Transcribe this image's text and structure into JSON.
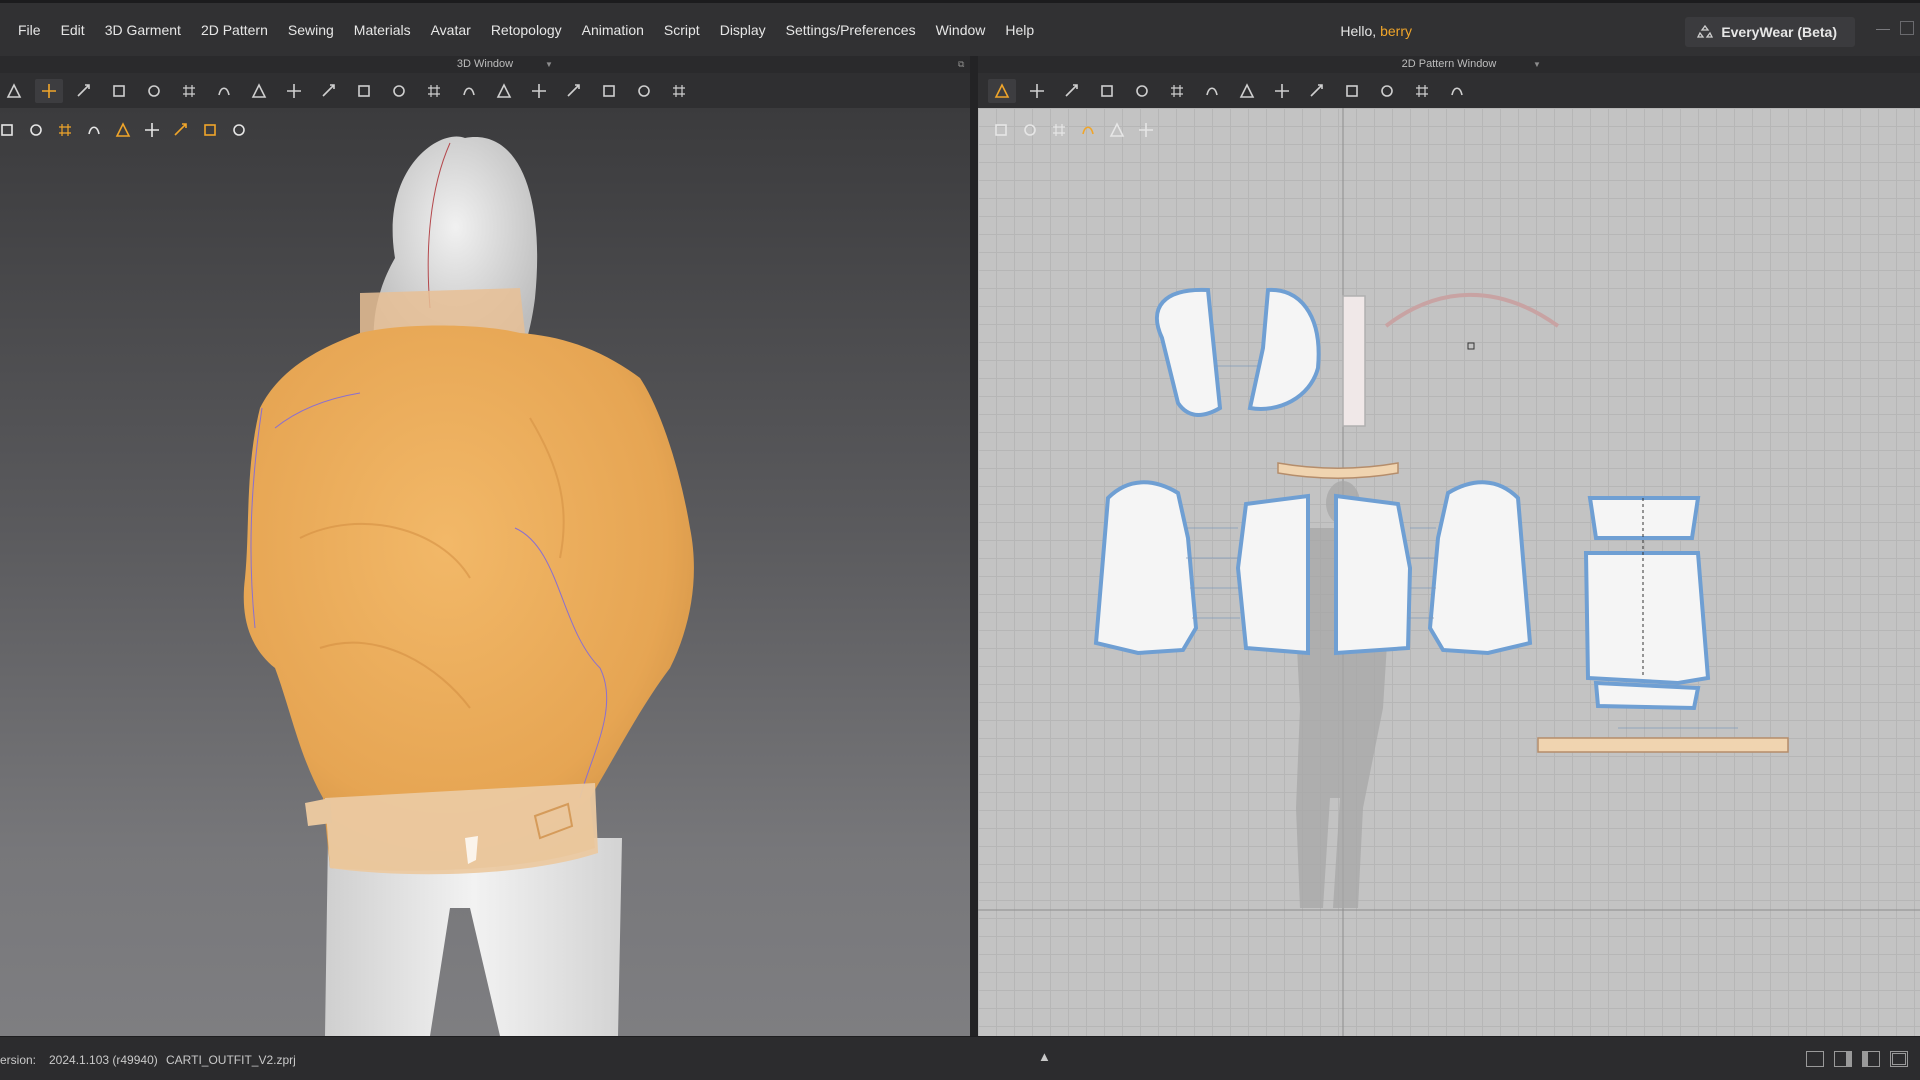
{
  "menu": {
    "items": [
      "File",
      "Edit",
      "3D Garment",
      "2D Pattern",
      "Sewing",
      "Materials",
      "Avatar",
      "Retopology",
      "Animation",
      "Script",
      "Display",
      "Settings/Preferences",
      "Window",
      "Help"
    ]
  },
  "header": {
    "greeting": "Hello,",
    "username": "berry",
    "product_label": "EveryWear (Beta)"
  },
  "windows": {
    "left_title": "3D Window",
    "right_title": "2D Pattern Window"
  },
  "toolbar_3d": {
    "icons": [
      "select-icon",
      "move-icon",
      "fold-icon",
      "garment-icon",
      "tape-icon",
      "arrange-icon",
      "box-select-icon",
      "pin-icon",
      "rotate-icon",
      "grid-icon",
      "bend-icon",
      "lasso-icon",
      "point-icon",
      "tack-icon",
      "flip-icon",
      "steam-icon",
      "split-icon",
      "measure-icon",
      "align-icon",
      "avatar-pose-icon"
    ]
  },
  "subtools_3d": {
    "icons": [
      "cube-icon",
      "shirt-icon",
      "sun-icon",
      "avatar-icon",
      "fabric-icon",
      "fold-icon",
      "skin-icon",
      "texture-icon",
      "export-icon"
    ]
  },
  "toolbar_2d": {
    "icons": [
      "transform-pattern-icon",
      "edit-point-icon",
      "rectangle-icon",
      "internal-shape-icon",
      "pin-icon",
      "trace-icon",
      "grid-icon",
      "seam-icon",
      "notch-icon",
      "fold-line-icon",
      "elastic-icon",
      "segment-icon",
      "measure-icon",
      "shirt-icon"
    ]
  },
  "subtools_2d": {
    "icons": [
      "brush-icon",
      "shirt-icon",
      "stitch-icon",
      "fabric-icon",
      "mannequin-icon",
      "export-icon"
    ]
  },
  "status": {
    "version_label": "ersion:",
    "version": "2024.1.103 (r49940)",
    "file": "CARTI_OUTFIT_V2.zprj"
  },
  "colors": {
    "accent": "#f0a52a",
    "jacket": "#e9a95a",
    "pattern_outline": "#6f9fd3",
    "background": "#313133"
  }
}
